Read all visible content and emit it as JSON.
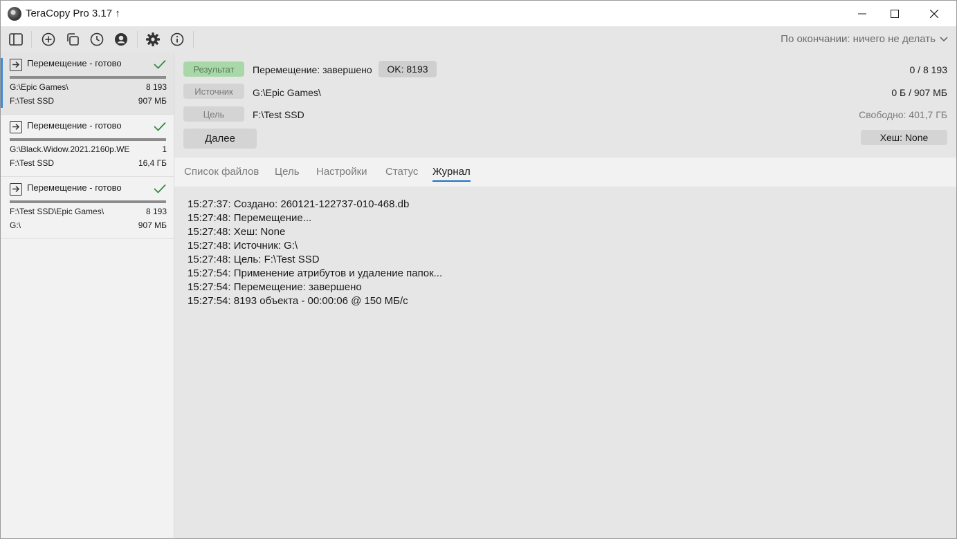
{
  "window": {
    "title": "TeraCopy Pro 3.17 ↑"
  },
  "toolbar": {
    "icons": [
      "sidebar-toggle-icon",
      "add-icon",
      "copy-icon",
      "history-icon",
      "account-icon",
      "settings-icon",
      "info-icon"
    ],
    "after_done": "По окончании: ничего не делать"
  },
  "jobs": [
    {
      "title": "Перемещение - готово",
      "source": "G:\\Epic Games\\",
      "source_count": "8 193",
      "target": "F:\\Test SSD",
      "size": "907 МБ",
      "progress": 1.0,
      "selected": true
    },
    {
      "title": "Перемещение - готово",
      "source": "G:\\Black.Widow.2021.2160p.WE",
      "source_count": "1",
      "target": "F:\\Test SSD",
      "size": "16,4 ГБ",
      "progress": 1.0,
      "selected": false
    },
    {
      "title": "Перемещение - готово",
      "source": "F:\\Test SSD\\Epic Games\\",
      "source_count": "8 193",
      "target": "G:\\",
      "size": "907 МБ",
      "progress": 1.0,
      "selected": false
    }
  ],
  "details": {
    "result_label": "Результат",
    "result_value": "Перемещение: завершено",
    "ok_badge": "OK: 8193",
    "count": "0 / 8 193",
    "source_label": "Источник",
    "source_value": "G:\\Epic Games\\",
    "size": "0 Б / 907 МБ",
    "target_label": "Цель",
    "target_value": "F:\\Test SSD",
    "free": "Свободно: 401,7 ГБ",
    "next_button": "Далее",
    "hash_button": "Хеш: None"
  },
  "tabs": [
    {
      "label": "Список файлов",
      "active": false
    },
    {
      "label": "Цель",
      "active": false
    },
    {
      "label": "Настройки",
      "active": false
    },
    {
      "label": "Статус",
      "active": false
    },
    {
      "label": "Журнал",
      "active": true
    }
  ],
  "log": [
    "15:27:37: Создано: 260121-122737-010-468.db",
    "15:27:48: Перемещение...",
    "15:27:48: Хеш: None",
    "15:27:48: Источник: G:\\",
    "15:27:48: Цель: F:\\Test SSD",
    "15:27:54: Применение атрибутов и удаление папок...",
    "15:27:54: Перемещение: завершено",
    "15:27:54: 8193 объекта - 00:00:06 @ 150 МБ/с"
  ],
  "colors": {
    "accent": "#1a73c8",
    "selection_marker": "#3d8bd6",
    "success_badge": "#a8d8a8",
    "check": "#2e8b3e"
  }
}
